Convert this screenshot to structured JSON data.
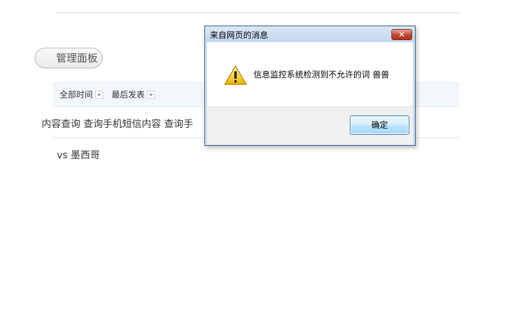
{
  "background_page": {
    "panel_button_label": "管理面板",
    "filters": [
      {
        "label": "全部时间"
      },
      {
        "label": "最后发表"
      }
    ],
    "rows": [
      {
        "text": "内容查询 查询手机短信内容 查询手"
      },
      {
        "text": "vs 墨西哥"
      }
    ]
  },
  "dialog": {
    "title": "来自网页的消息",
    "close_label": "✕",
    "icon": "warning-icon",
    "message": "信息监控系统检测到不允许的词 兽兽",
    "ok_label": "确定"
  },
  "colors": {
    "dialog_frame": "#cfe0f1",
    "close_button": "#c6452f",
    "ok_button_border": "#3c7fb1",
    "filter_bar": "#f2f7fb"
  }
}
